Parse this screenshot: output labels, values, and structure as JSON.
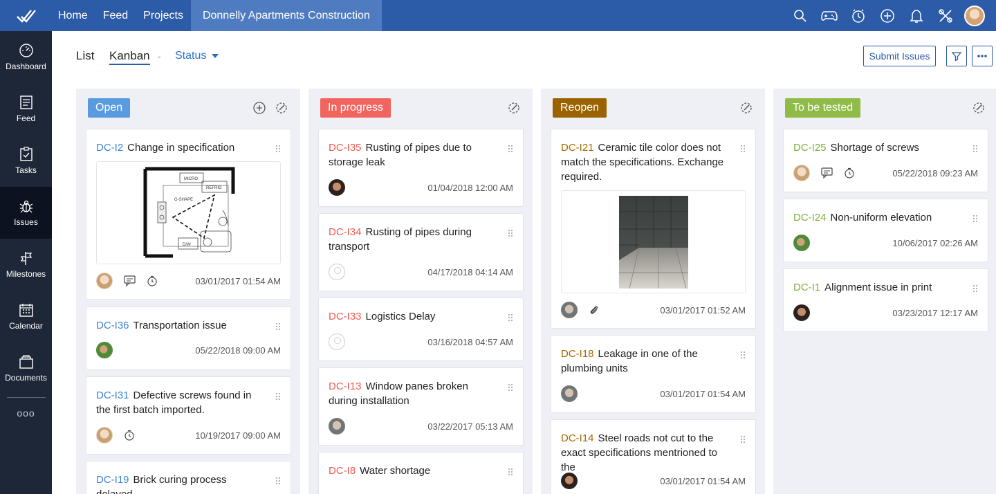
{
  "topnav": {
    "home": "Home",
    "feed": "Feed",
    "projects": "Projects",
    "project_title": "Donnelly Apartments Construction",
    "icons": [
      "search-icon",
      "gamepad-icon",
      "timer-icon",
      "add-icon",
      "bell-icon",
      "tools-icon"
    ]
  },
  "sidebar": {
    "items": [
      {
        "label": "Dashboard",
        "icon": "dashboard-icon"
      },
      {
        "label": "Feed",
        "icon": "feed-icon"
      },
      {
        "label": "Tasks",
        "icon": "tasks-icon"
      },
      {
        "label": "Issues",
        "icon": "bug-icon",
        "active": true
      },
      {
        "label": "Milestones",
        "icon": "milestone-icon"
      },
      {
        "label": "Calendar",
        "icon": "calendar-icon"
      },
      {
        "label": "Documents",
        "icon": "documents-icon"
      }
    ],
    "more": "ooo"
  },
  "toolbar": {
    "list": "List",
    "kanban": "Kanban",
    "separator": "-",
    "status": "Status",
    "submit": "Submit Issues"
  },
  "colors": {
    "topbar": "#2c5ba7",
    "open": "#5a9be0",
    "in_progress": "#f2655f",
    "reopen": "#9a6300",
    "to_be_tested": "#8fbb46",
    "id_open": "#3c84d6",
    "id_progress": "#ee5a52",
    "id_reopen": "#a66a00",
    "id_tested": "#7fae3b"
  },
  "columns": [
    {
      "name": "Open",
      "cards": [
        {
          "id": "DC-I2",
          "title": "Change in specification",
          "date": "03/01/2017 01:54 AM",
          "image": "floor-plan"
        },
        {
          "id": "DC-I36",
          "title": "Transportation issue",
          "date": "05/22/2018 09:00 AM"
        },
        {
          "id": "DC-I31",
          "title": "Defective screws found in the first batch imported.",
          "date": "10/19/2017 09:00 AM"
        },
        {
          "id": "DC-I19",
          "title": "Brick curing process delayed",
          "date": ""
        }
      ]
    },
    {
      "name": "In progress",
      "cards": [
        {
          "id": "DC-I35",
          "title": "Rusting of pipes due to storage leak",
          "date": "01/04/2018 12:00 AM"
        },
        {
          "id": "DC-I34",
          "title": "Rusting of pipes during transport",
          "date": "04/17/2018 04:14 AM"
        },
        {
          "id": "DC-I33",
          "title": "Logistics Delay",
          "date": "03/16/2018 04:57 AM"
        },
        {
          "id": "DC-I13",
          "title": "Window panes broken during installation",
          "date": "03/22/2017 05:13 AM"
        },
        {
          "id": "DC-I8",
          "title": "Water shortage",
          "date": ""
        }
      ]
    },
    {
      "name": "Reopen",
      "cards": [
        {
          "id": "DC-I21",
          "title": "Ceramic tile color does not match the specifications. Exchange required.",
          "date": "03/01/2017 01:52 AM",
          "image": "tile-photo"
        },
        {
          "id": "DC-I18",
          "title": "Leakage in one of the plumbing units",
          "date": "03/01/2017 01:54 AM"
        },
        {
          "id": "DC-I14",
          "title": "Steel roads not cut to the exact specifications mentrioned to the",
          "date": "03/01/2017 01:54 AM"
        }
      ]
    },
    {
      "name": "To be tested",
      "cards": [
        {
          "id": "DC-I25",
          "title": "Shortage of screws",
          "date": "05/22/2018 09:23 AM"
        },
        {
          "id": "DC-I24",
          "title": "Non-uniform elevation",
          "date": "10/06/2017 02:26 AM"
        },
        {
          "id": "DC-I1",
          "title": "Alignment issue in print",
          "date": "03/23/2017 12:17 AM"
        }
      ]
    }
  ],
  "floor_plan_labels": {
    "micro": "MICRO",
    "refrig": "REFRIG",
    "shape": "G-SHAPE",
    "dw": "D/W"
  }
}
